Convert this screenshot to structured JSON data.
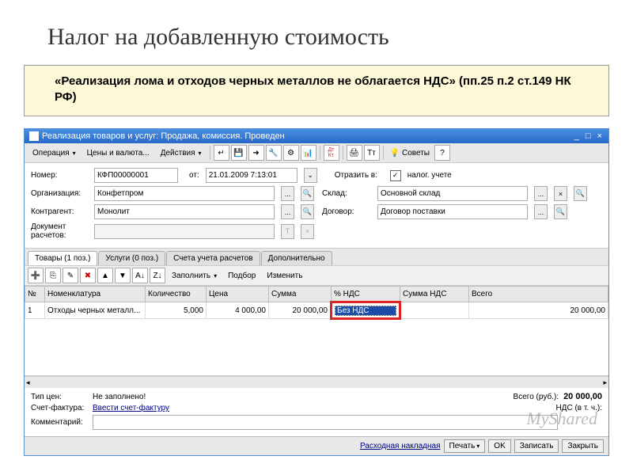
{
  "slide": {
    "title": "Налог на добавленную стоимость",
    "note": "«Реализация лома и отходов черных металлов не облагается НДС» (пп.25 п.2 ст.149 НК РФ)"
  },
  "window": {
    "title": "Реализация товаров и услуг: Продажа, комиссия. Проведен"
  },
  "menu": {
    "operation": "Операция",
    "prices": "Цены и валюта...",
    "actions": "Действия",
    "tips": "Советы"
  },
  "form": {
    "number_label": "Номер:",
    "number": "КФП00000001",
    "date_label": "от:",
    "date": "21.01.2009 7:13:01",
    "reflect_label": "Отразить в:",
    "reflect_val": "налог. учете",
    "org_label": "Организация:",
    "org": "Конфетпром",
    "warehouse_label": "Склад:",
    "warehouse": "Основной склад",
    "counter_label": "Контрагент:",
    "counter": "Монолит",
    "contract_label": "Договор:",
    "contract": "Договор поставки",
    "doc_label": "Документ расчетов:"
  },
  "tabs": {
    "goods": "Товары (1 поз.)",
    "services": "Услуги (0 поз.)",
    "accounts": "Счета учета расчетов",
    "more": "Дополнительно"
  },
  "tabtb": {
    "fill": "Заполнить",
    "select": "Подбор",
    "edit": "Изменить"
  },
  "grid": {
    "cols": {
      "n": "№",
      "nom": "Номенклатура",
      "qty": "Количество",
      "price": "Цена",
      "sum": "Сумма",
      "vat": "% НДС",
      "vatsum": "Сумма НДС",
      "total": "Всего"
    },
    "row": {
      "n": "1",
      "nom": "Отходы черных металл...",
      "qty": "5,000",
      "price": "4 000,00",
      "sum": "20 000,00",
      "vat": "Без НДС",
      "vatsum": "",
      "total": "20 000,00"
    }
  },
  "bottom": {
    "pricetype_label": "Тип цен:",
    "pricetype": "Не заполнено!",
    "invoice_label": "Счет-фактура:",
    "invoice": "Ввести счет-фактуру",
    "comment_label": "Комментарий:",
    "total_label": "Всего (руб.):",
    "total_val": "20 000,00",
    "vat_label": "НДС (в т. ч.):"
  },
  "footer": {
    "waybill": "Расходная накладная",
    "print": "Печать",
    "ok": "OK",
    "save": "Записать",
    "close": "Закрыть"
  },
  "watermark": "MyShared"
}
